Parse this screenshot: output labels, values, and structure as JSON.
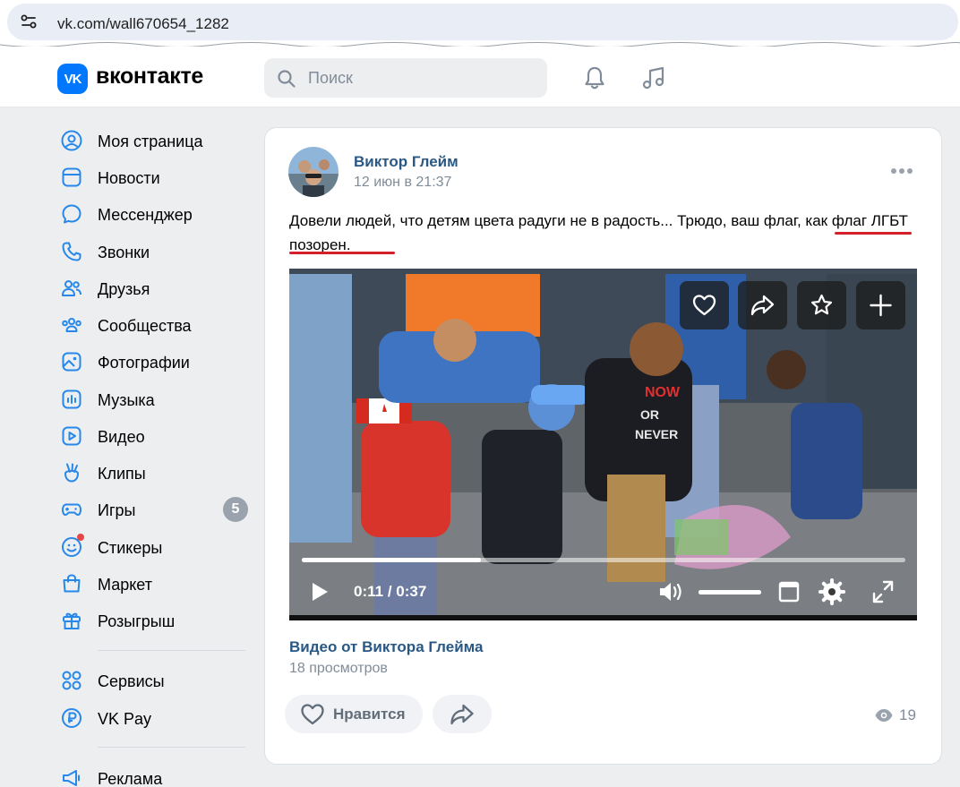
{
  "browser": {
    "url": "vk.com/wall670654_1282"
  },
  "header": {
    "logo_text": "VK",
    "brand": "вконтакте",
    "search_placeholder": "Поиск"
  },
  "sidebar": {
    "items": [
      {
        "label": "Моя страница",
        "icon": "user-circle-icon"
      },
      {
        "label": "Новости",
        "icon": "news-icon"
      },
      {
        "label": "Мессенджер",
        "icon": "message-icon"
      },
      {
        "label": "Звонки",
        "icon": "phone-icon"
      },
      {
        "label": "Друзья",
        "icon": "friends-icon"
      },
      {
        "label": "Сообщества",
        "icon": "communities-icon"
      },
      {
        "label": "Фотографии",
        "icon": "photo-icon"
      },
      {
        "label": "Музыка",
        "icon": "music-icon"
      },
      {
        "label": "Видео",
        "icon": "video-icon"
      },
      {
        "label": "Клипы",
        "icon": "clips-icon"
      },
      {
        "label": "Игры",
        "icon": "gamepad-icon",
        "badge": "5"
      },
      {
        "label": "Стикеры",
        "icon": "sticker-icon"
      },
      {
        "label": "Маркет",
        "icon": "market-icon"
      },
      {
        "label": "Розыгрыш",
        "icon": "gift-icon"
      },
      {
        "label": "Сервисы",
        "icon": "services-icon"
      },
      {
        "label": "VK Pay",
        "icon": "vkpay-icon"
      },
      {
        "label": "Реклама",
        "icon": "megaphone-icon"
      }
    ]
  },
  "post": {
    "author": "Виктор Глейм",
    "date": "12 июн в 21:37",
    "text": "Довели людей, что детям цвета радуги не в радость... Трюдо, ваш флаг, как флаг ЛГБТ позорен.",
    "video": {
      "current_time": "0:11",
      "duration": "0:37",
      "progress": 0.297,
      "volume": 1.0,
      "shirt_text_1": "NOW",
      "shirt_text_2": "OR",
      "shirt_text_3": "NEVER"
    },
    "video_title": "Видео от Виктора Глейма",
    "video_views": "18 просмотров",
    "like_label": "Нравится",
    "views_count": "19"
  },
  "colors": {
    "vk_blue": "#0077ff",
    "link": "#2a5885",
    "muted": "#818c99",
    "underline": "#d3202a"
  }
}
